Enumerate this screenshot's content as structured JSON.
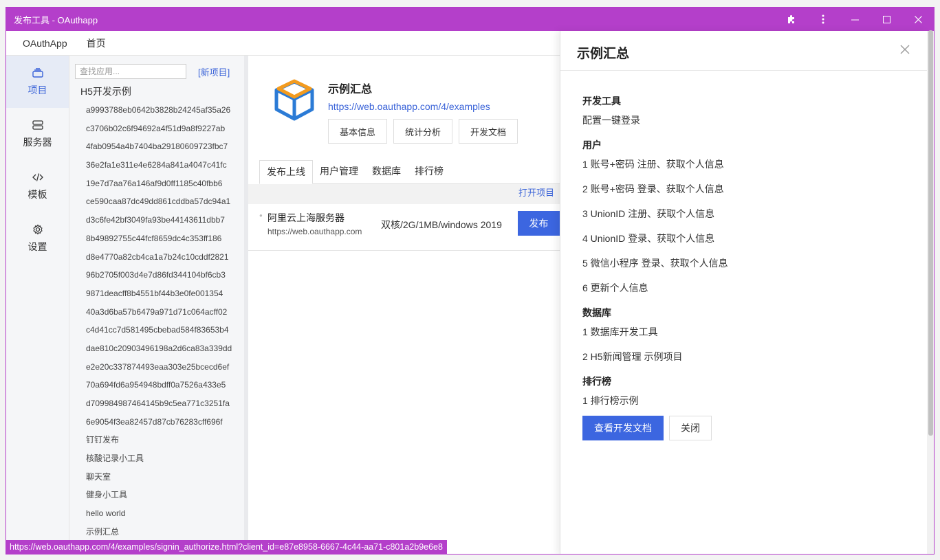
{
  "window": {
    "title": "发布工具 - OAuthapp",
    "accent": "#b43fca",
    "icons": [
      "puzzle-icon",
      "more-vertical-icon",
      "minimize-icon",
      "maximize-icon",
      "close-icon"
    ]
  },
  "menubar": {
    "items": [
      {
        "label": "OAuthApp"
      },
      {
        "label": "首页"
      }
    ]
  },
  "leftnav": {
    "items": [
      {
        "label": "项目",
        "icon": "layers-icon",
        "active": true
      },
      {
        "label": "服务器",
        "icon": "server-icon"
      },
      {
        "label": "模板",
        "icon": "code-icon"
      },
      {
        "label": "设置",
        "icon": "gear-icon"
      }
    ]
  },
  "applist": {
    "search_placeholder": "查找应用...",
    "new_label": "[新项目]",
    "group_title": "H5开发示例",
    "items": [
      "a9993788eb0642b3828b24245af35a26",
      "c3706b02c6f94692a4f51d9a8f9227ab",
      "4fab0954a4b7404ba29180609723fbc7",
      "36e2fa1e311e4e6284a841a4047c41fc",
      "19e7d7aa76a146af9d0ff1185c40fbb6",
      "ce590caa87dc49dd861cddba57dc94a1",
      "d3c6fe42bf3049fa93be44143611dbb7",
      "8b49892755c44fcf8659dc4c353ff186",
      "d8e4770a82cb4ca1a7b24c10cddf2821",
      "96b2705f003d4e7d86fd344104bf6cb3",
      "9871deacff8b4551bf44b3e0fe001354",
      "40a3d6ba57b6479a971d71c064acff02",
      "c4d41cc7d581495cbebad584f83653b4",
      "dae810c20903496198a2d6ca83a339dd",
      "e2e20c337874493eaa303e25bcecd6ef",
      "70a694fd6a954948bdff0a7526a433e5",
      "d709984987464145b9c5ea771c3251fa",
      "6e9054f3ea82457d87cb76283cff696f",
      "钉钉发布",
      "核酸记录小工具",
      "聊天室",
      "健身小工具",
      "hello world",
      "示例汇总"
    ]
  },
  "project": {
    "title": "示例汇总",
    "url": "https://web.oauthapp.com/4/examples",
    "buttons": [
      "基本信息",
      "统计分析",
      "开发文档"
    ],
    "tabs": [
      {
        "label": "发布上线",
        "active": true
      },
      {
        "label": "用户管理"
      },
      {
        "label": "数据库"
      },
      {
        "label": "排行榜"
      }
    ],
    "open_label": "打开项目",
    "server": {
      "name": "阿里云上海服务器",
      "url": "https://web.oauthapp.com",
      "spec": "双核/2G/1MB/windows 2019",
      "publish_label": "发布"
    }
  },
  "drawer": {
    "title": "示例汇总",
    "sections": [
      {
        "title": "开发工具",
        "items": [
          "配置一键登录"
        ]
      },
      {
        "title": "用户",
        "items": [
          "1 账号+密码 注册、获取个人信息",
          "2 账号+密码 登录、获取个人信息",
          "3 UnionID 注册、获取个人信息",
          "4 UnionID 登录、获取个人信息",
          "5 微信小程序 登录、获取个人信息",
          "6 更新个人信息"
        ]
      },
      {
        "title": "数据库",
        "items": [
          "1 数据库开发工具",
          "2 H5新闻管理 示例项目"
        ]
      },
      {
        "title": "排行榜",
        "items": [
          "1 排行榜示例"
        ]
      }
    ],
    "primary_label": "查看开发文档",
    "close_label": "关闭"
  },
  "statusbar": {
    "text": "https://web.oauthapp.com/4/examples/signin_authorize.html?client_id=e87e8958-6667-4c44-aa71-c801a2b9e6e8"
  },
  "colors": {
    "primary": "#3c66e0",
    "link": "#3a63d8"
  }
}
